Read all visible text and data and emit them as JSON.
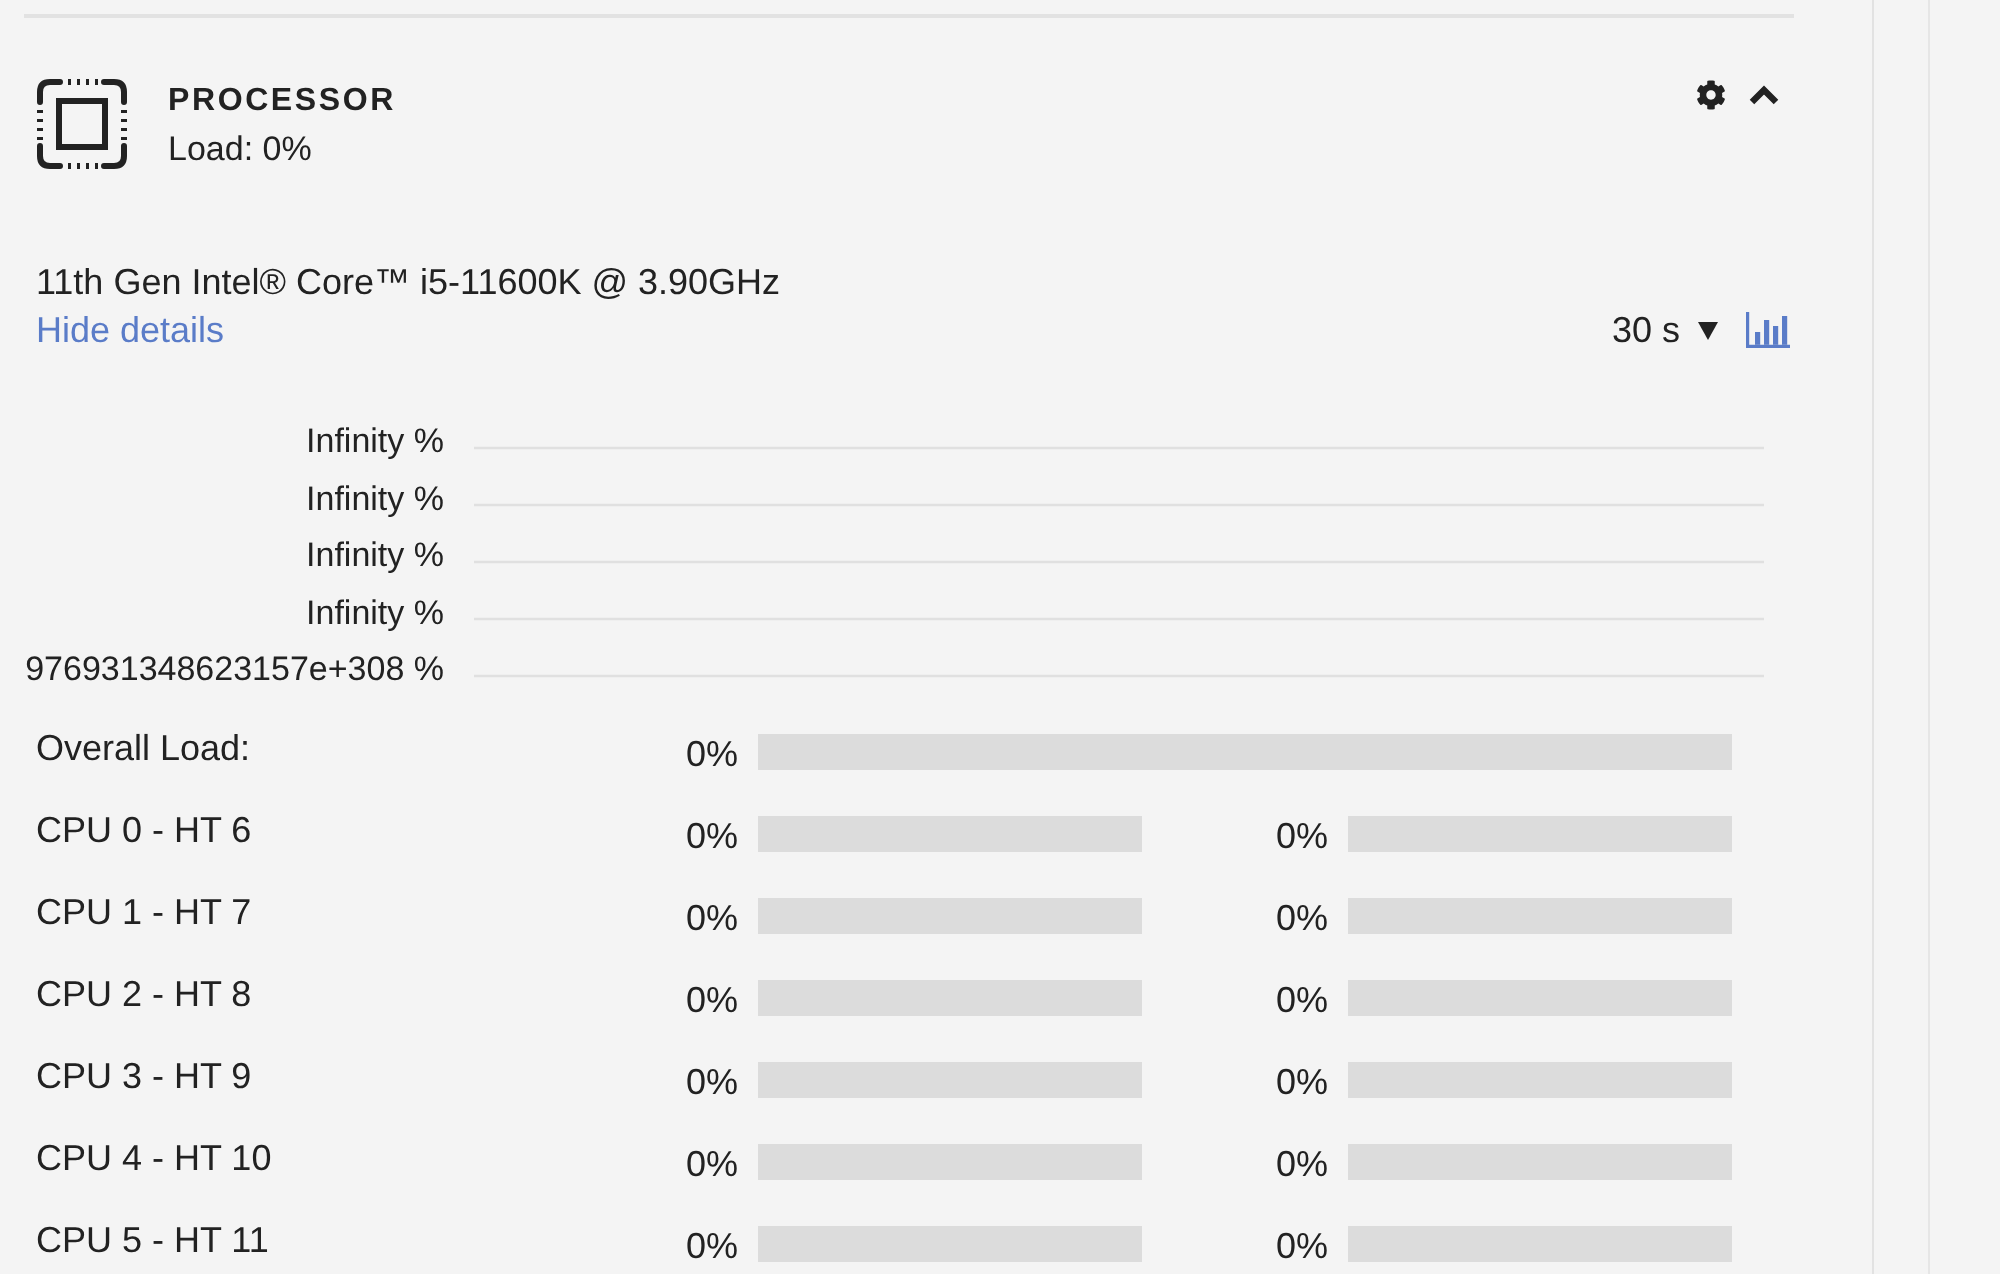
{
  "panel": {
    "title": "PROCESSOR",
    "load": "Load: 0%",
    "expanded": true,
    "model": "11th Gen Intel® Core™ i5-11600K @ 3.90GHz",
    "details_link": "Hide details"
  },
  "history": {
    "interval": "30 s",
    "y_axis_labels": [
      "Infinity %",
      "Infinity %",
      "Infinity %",
      "Infinity %",
      "976931348623157e+308 %"
    ]
  },
  "overall": {
    "label": "Overall Load:",
    "reading": "0%",
    "level": 0
  },
  "cores": [
    {
      "label": "CPU 0 - HT 6",
      "threads": [
        {
          "reading": "0%",
          "level": 0
        },
        {
          "reading": "0%",
          "level": 0
        }
      ]
    },
    {
      "label": "CPU 1 - HT 7",
      "threads": [
        {
          "reading": "0%",
          "level": 0
        },
        {
          "reading": "0%",
          "level": 0
        }
      ]
    },
    {
      "label": "CPU 2 - HT 8",
      "threads": [
        {
          "reading": "0%",
          "level": 0
        },
        {
          "reading": "0%",
          "level": 0
        }
      ]
    },
    {
      "label": "CPU 3 - HT 9",
      "threads": [
        {
          "reading": "0%",
          "level": 0
        },
        {
          "reading": "0%",
          "level": 0
        }
      ]
    },
    {
      "label": "CPU 4 - HT 10",
      "threads": [
        {
          "reading": "0%",
          "level": 0
        },
        {
          "reading": "0%",
          "level": 0
        }
      ]
    },
    {
      "label": "CPU 5 - HT 11",
      "threads": [
        {
          "reading": "0%",
          "level": 0
        },
        {
          "reading": "0%",
          "level": 0
        }
      ]
    }
  ]
}
